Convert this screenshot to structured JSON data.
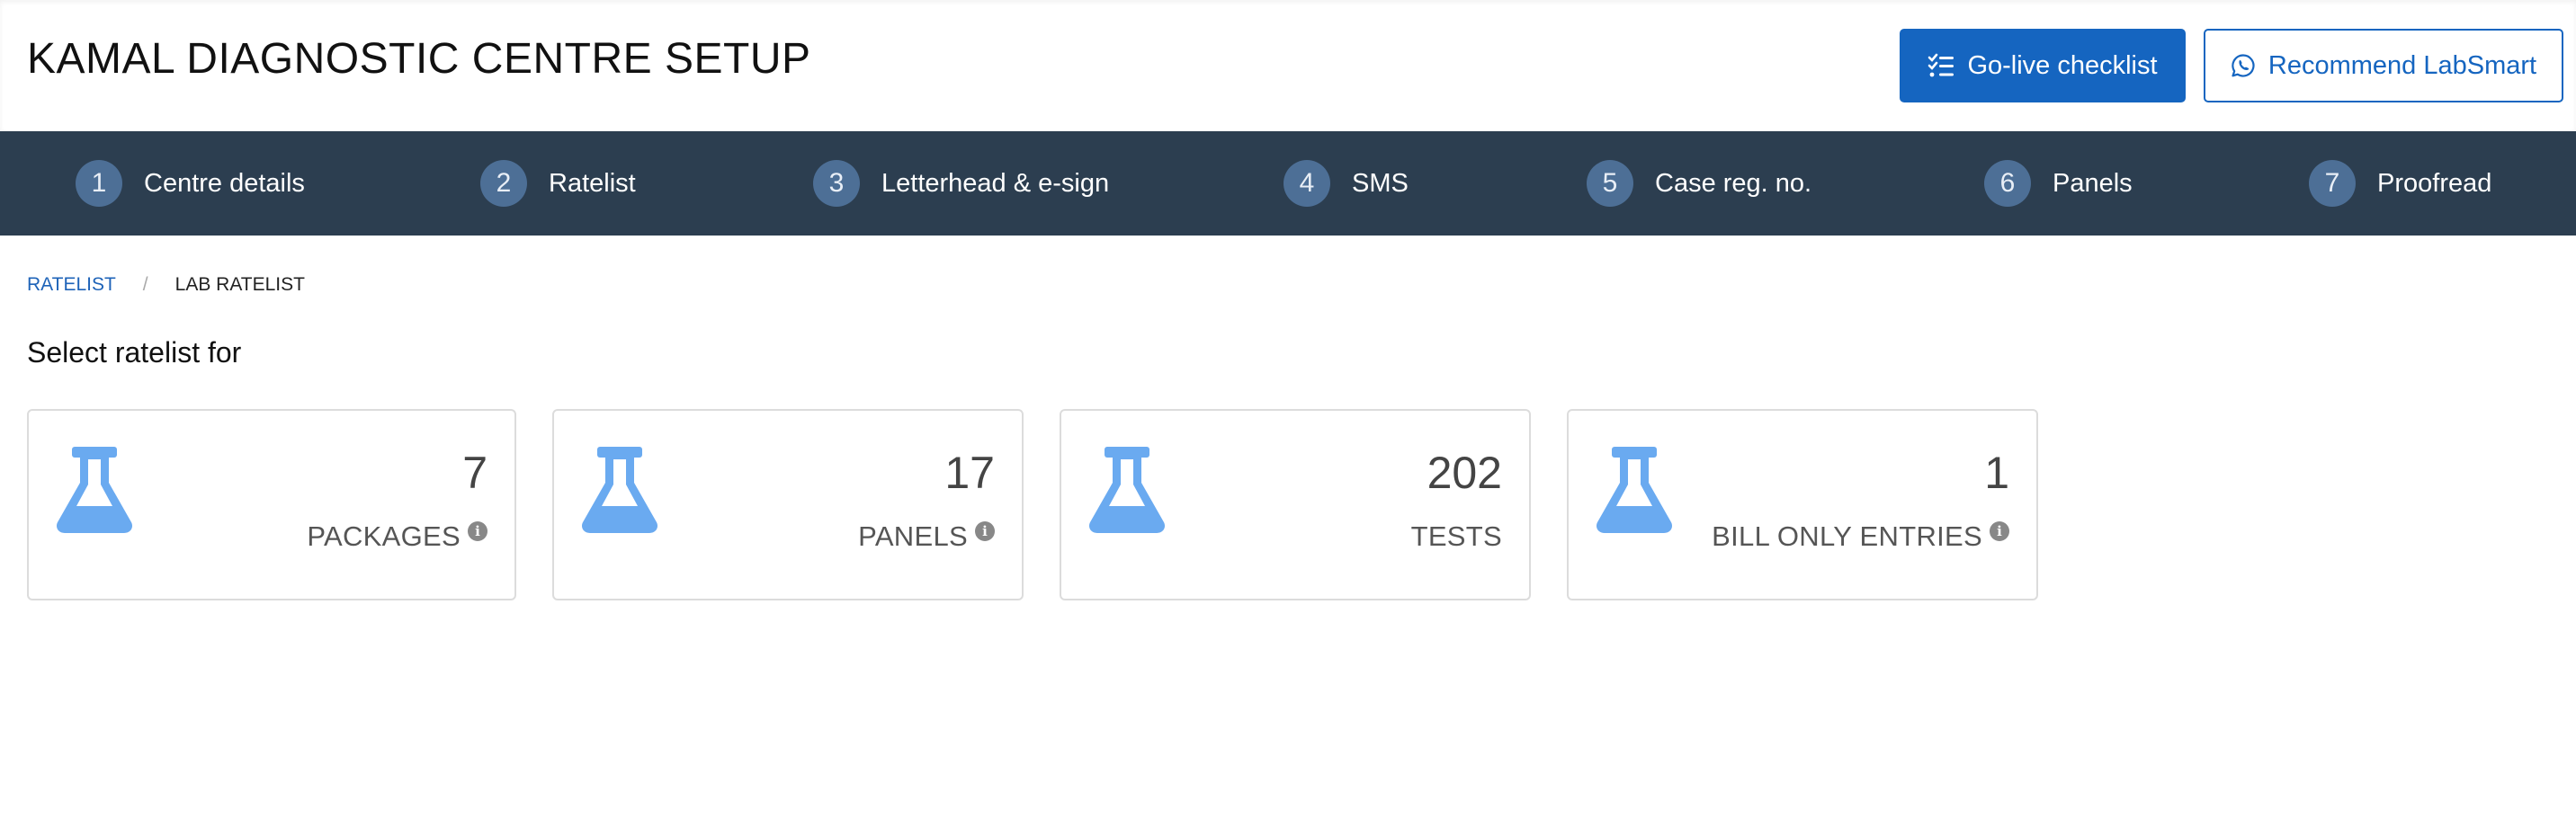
{
  "header": {
    "title": "KAMAL DIAGNOSTIC CENTRE SETUP",
    "golive_label": "Go-live checklist",
    "recommend_label": "Recommend LabSmart"
  },
  "steps": [
    {
      "number": "1",
      "label": "Centre details"
    },
    {
      "number": "2",
      "label": "Ratelist"
    },
    {
      "number": "3",
      "label": "Letterhead & e-sign"
    },
    {
      "number": "4",
      "label": "SMS"
    },
    {
      "number": "5",
      "label": "Case reg. no."
    },
    {
      "number": "6",
      "label": "Panels"
    },
    {
      "number": "7",
      "label": "Proofread"
    }
  ],
  "breadcrumb": {
    "parent": "RATELIST",
    "separator": "/",
    "current": "LAB RATELIST"
  },
  "section_title": "Select ratelist for",
  "cards": [
    {
      "count": "7",
      "label": "PACKAGES",
      "info": true
    },
    {
      "count": "17",
      "label": "PANELS",
      "info": true
    },
    {
      "count": "202",
      "label": "TESTS",
      "info": false
    },
    {
      "count": "1",
      "label": "BILL ONLY ENTRIES",
      "info": true
    }
  ],
  "icons": {
    "golive": "checklist-icon",
    "recommend": "whatsapp-icon",
    "card": "flask-icon",
    "info": "info-icon"
  },
  "colors": {
    "primary": "#1565c0",
    "stepbar": "#2c3e50",
    "step_circle": "#4d6f96",
    "flask": "#6aaaf0"
  }
}
